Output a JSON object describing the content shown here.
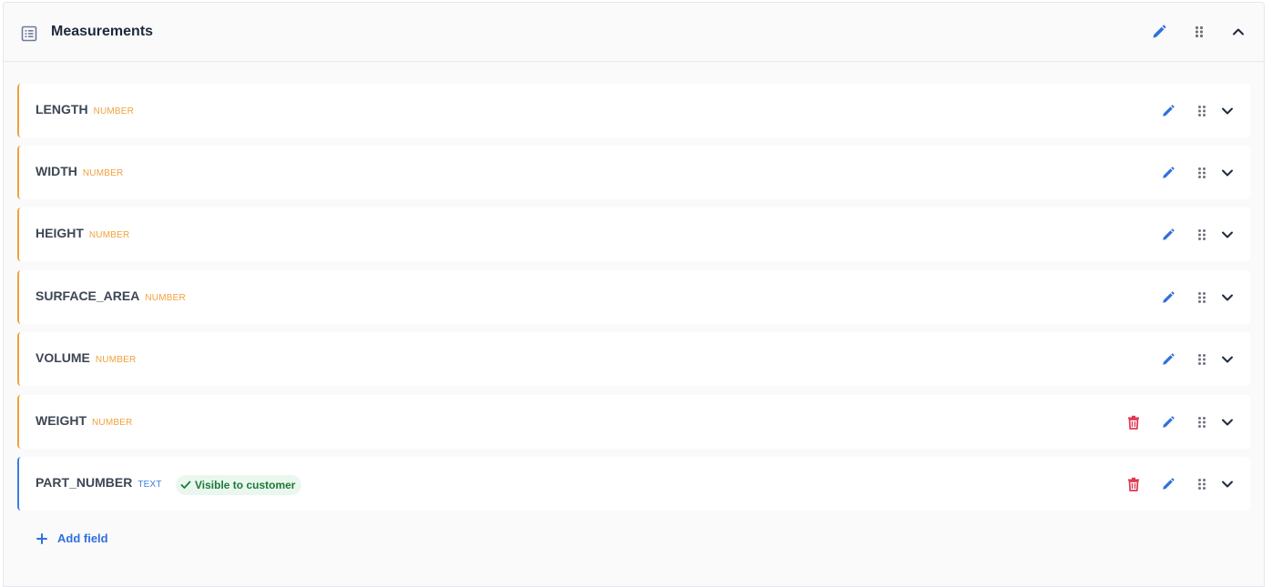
{
  "section": {
    "title": "Measurements",
    "icon": "list-table-icon",
    "collapse_icon": "chevron-up-icon"
  },
  "fields": [
    {
      "name": "LENGTH",
      "type": "NUMBER",
      "deletable": false,
      "visible_to_customer": false
    },
    {
      "name": "WIDTH",
      "type": "NUMBER",
      "deletable": false,
      "visible_to_customer": false
    },
    {
      "name": "HEIGHT",
      "type": "NUMBER",
      "deletable": false,
      "visible_to_customer": false
    },
    {
      "name": "SURFACE_AREA",
      "type": "NUMBER",
      "deletable": false,
      "visible_to_customer": false
    },
    {
      "name": "VOLUME",
      "type": "NUMBER",
      "deletable": false,
      "visible_to_customer": false
    },
    {
      "name": "WEIGHT",
      "type": "NUMBER",
      "deletable": true,
      "visible_to_customer": false
    },
    {
      "name": "PART_NUMBER",
      "type": "TEXT",
      "deletable": true,
      "visible_to_customer": true,
      "badge_label": "Visible to customer"
    }
  ],
  "add_field_label": "Add field",
  "colors": {
    "number_accent": "#f0a23b",
    "text_accent": "#3b7de0",
    "edit_blue": "#2f6fde",
    "delete_red": "#e0364f",
    "badge_green": "#1b7a3a"
  }
}
